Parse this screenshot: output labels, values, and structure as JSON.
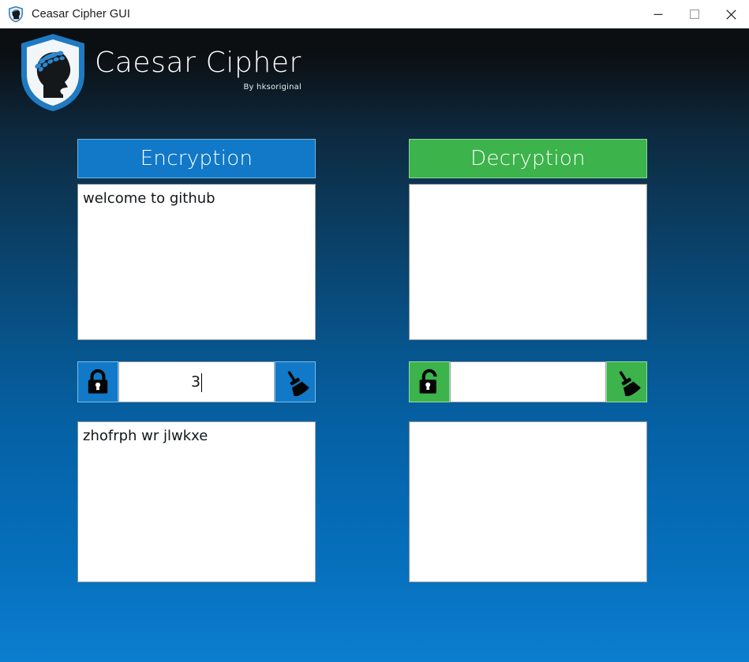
{
  "window": {
    "title": "Ceasar Cipher GUI",
    "icon": "shield-app-icon",
    "controls": {
      "minimize": "minimize-icon",
      "maximize": "maximize-icon",
      "close": "close-icon"
    }
  },
  "branding": {
    "logo_icon": "caesar-shield-logo",
    "title": "Caesar Cipher",
    "subtitle": "By hksoriginal"
  },
  "colors": {
    "encryption_accent": "#1179c8",
    "decryption_accent": "#3cb34b",
    "background_top": "#0b0f12",
    "background_bottom": "#0c7ecf",
    "text_on_accent": "#ffffff"
  },
  "panels": {
    "encryption": {
      "header_label": "Encryption",
      "accent": "#1179c8",
      "input": {
        "value": "welcome to github",
        "placeholder": ""
      },
      "key_row": {
        "lock_icon": "lock-closed-icon",
        "clear_icon": "broom-icon",
        "key_value": "3",
        "key_placeholder": "",
        "caret_visible": true
      },
      "output": {
        "value": "zhofrph wr jlwkxe",
        "placeholder": ""
      }
    },
    "decryption": {
      "header_label": "Decryption",
      "accent": "#3cb34b",
      "input": {
        "value": "",
        "placeholder": ""
      },
      "key_row": {
        "lock_icon": "lock-open-icon",
        "clear_icon": "broom-icon",
        "key_value": "",
        "key_placeholder": "",
        "caret_visible": false
      },
      "output": {
        "value": "",
        "placeholder": ""
      }
    }
  }
}
